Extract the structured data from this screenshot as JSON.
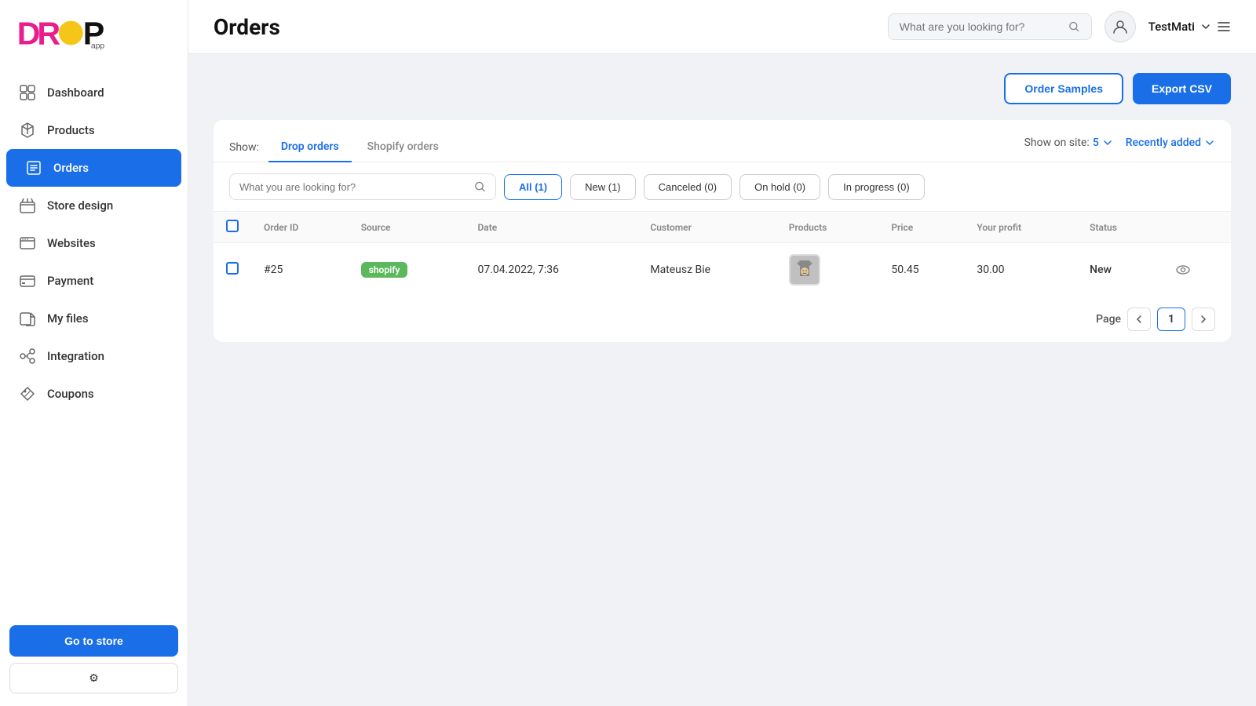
{
  "sidebar": {
    "logo_text": "DROPapp",
    "nav_items": [
      {
        "id": "dashboard",
        "label": "Dashboard",
        "icon": "dashboard-icon"
      },
      {
        "id": "products",
        "label": "Products",
        "icon": "products-icon"
      },
      {
        "id": "orders",
        "label": "Orders",
        "icon": "orders-icon",
        "active": true
      },
      {
        "id": "store-design",
        "label": "Store design",
        "icon": "store-design-icon"
      },
      {
        "id": "websites",
        "label": "Websites",
        "icon": "websites-icon"
      },
      {
        "id": "payment",
        "label": "Payment",
        "icon": "payment-icon"
      },
      {
        "id": "my-files",
        "label": "My files",
        "icon": "files-icon"
      },
      {
        "id": "integration",
        "label": "Integration",
        "icon": "integration-icon"
      },
      {
        "id": "coupons",
        "label": "Coupons",
        "icon": "coupons-icon"
      }
    ],
    "go_to_store_label": "Go to store"
  },
  "header": {
    "title": "Orders",
    "search_placeholder": "What are you looking for?",
    "user_name": "TestMati"
  },
  "actions": {
    "order_samples_label": "Order Samples",
    "export_csv_label": "Export CSV"
  },
  "orders": {
    "show_label": "Show:",
    "tab_drop": "Drop orders",
    "tab_shopify": "Shopify orders",
    "show_on_site_label": "Show on site:",
    "show_on_site_value": "5",
    "sort_label": "Recently added",
    "filter_placeholder": "What you are looking for?",
    "filter_buttons": [
      {
        "label": "All (1)",
        "active": true
      },
      {
        "label": "New (1)",
        "active": false
      },
      {
        "label": "Canceled (0)",
        "active": false
      },
      {
        "label": "On hold (0)",
        "active": false
      },
      {
        "label": "In progress (0)",
        "active": false
      }
    ],
    "table_headers": [
      {
        "id": "order-id",
        "label": "Order ID"
      },
      {
        "id": "source",
        "label": "Source"
      },
      {
        "id": "date",
        "label": "Date"
      },
      {
        "id": "customer",
        "label": "Customer"
      },
      {
        "id": "products",
        "label": "Products"
      },
      {
        "id": "price",
        "label": "Price"
      },
      {
        "id": "profit",
        "label": "Your profit"
      },
      {
        "id": "status",
        "label": "Status"
      }
    ],
    "rows": [
      {
        "id": "#25",
        "source": "shopify",
        "date": "07.04.2022, 7:36",
        "customer": "Mateusz Bie",
        "price": "50.45",
        "profit": "30.00",
        "status": "New"
      }
    ],
    "page_label": "Page",
    "current_page": "1"
  }
}
